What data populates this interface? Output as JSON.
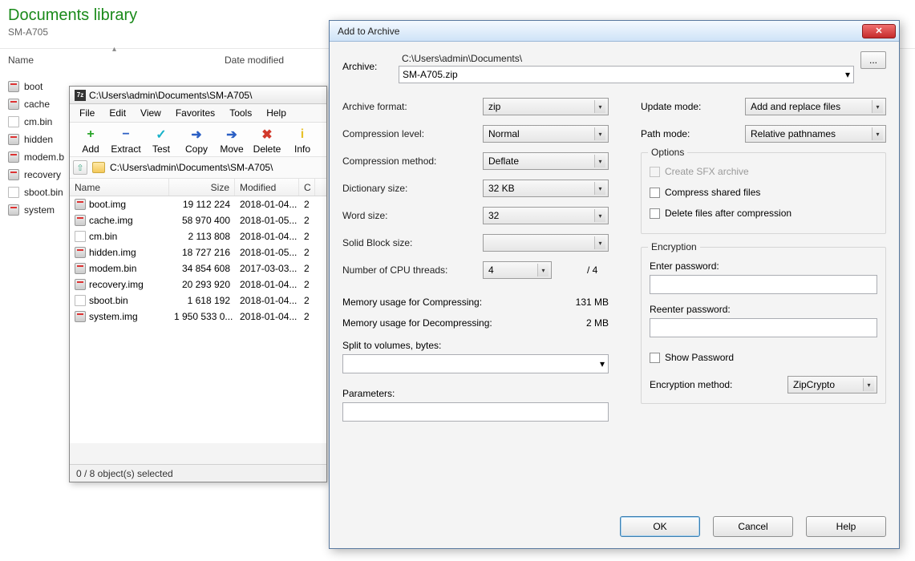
{
  "explorer": {
    "title": "Documents library",
    "subtitle": "SM-A705",
    "col_name": "Name",
    "col_date": "Date modified",
    "items": [
      {
        "name": "boot",
        "type": "disk"
      },
      {
        "name": "cache",
        "type": "disk"
      },
      {
        "name": "cm.bin",
        "type": "file"
      },
      {
        "name": "hidden",
        "type": "disk"
      },
      {
        "name": "modem.b",
        "type": "disk"
      },
      {
        "name": "recovery",
        "type": "disk"
      },
      {
        "name": "sboot.bin",
        "type": "file"
      },
      {
        "name": "system",
        "type": "disk"
      }
    ]
  },
  "sevenzip": {
    "title": "C:\\Users\\admin\\Documents\\SM-A705\\",
    "menu": [
      "File",
      "Edit",
      "View",
      "Favorites",
      "Tools",
      "Help"
    ],
    "tools": [
      {
        "label": "Add",
        "icon": "+",
        "color": "#2aa52a"
      },
      {
        "label": "Extract",
        "icon": "−",
        "color": "#2b5fc4"
      },
      {
        "label": "Test",
        "icon": "✓",
        "color": "#18b2c9"
      },
      {
        "label": "Copy",
        "icon": "➜",
        "color": "#2b5fc4"
      },
      {
        "label": "Move",
        "icon": "➔",
        "color": "#2b5fc4"
      },
      {
        "label": "Delete",
        "icon": "✖",
        "color": "#d23a2c"
      },
      {
        "label": "Info",
        "icon": "i",
        "color": "#e7c12a"
      }
    ],
    "address": "C:\\Users\\admin\\Documents\\SM-A705\\",
    "cols": {
      "name": "Name",
      "size": "Size",
      "modified": "Modified",
      "x": "C"
    },
    "rows": [
      {
        "name": "boot.img",
        "type": "disk",
        "size": "19 112 224",
        "mod": "2018-01-04...",
        "x": "2"
      },
      {
        "name": "cache.img",
        "type": "disk",
        "size": "58 970 400",
        "mod": "2018-01-05...",
        "x": "2"
      },
      {
        "name": "cm.bin",
        "type": "file",
        "size": "2 113 808",
        "mod": "2018-01-04...",
        "x": "2"
      },
      {
        "name": "hidden.img",
        "type": "disk",
        "size": "18 727 216",
        "mod": "2018-01-05...",
        "x": "2"
      },
      {
        "name": "modem.bin",
        "type": "disk",
        "size": "34 854 608",
        "mod": "2017-03-03...",
        "x": "2"
      },
      {
        "name": "recovery.img",
        "type": "disk",
        "size": "20 293 920",
        "mod": "2018-01-04...",
        "x": "2"
      },
      {
        "name": "sboot.bin",
        "type": "file",
        "size": "1 618 192",
        "mod": "2018-01-04...",
        "x": "2"
      },
      {
        "name": "system.img",
        "type": "disk",
        "size": "1 950 533 0...",
        "mod": "2018-01-04...",
        "x": "2"
      }
    ],
    "status": "0 / 8 object(s) selected"
  },
  "dialog": {
    "title": "Add to Archive",
    "archive_label": "Archive:",
    "archive_path": "C:\\Users\\admin\\Documents\\",
    "archive_file": "SM-A705.zip",
    "browse": "...",
    "fields": {
      "format_lbl": "Archive format:",
      "format_val": "zip",
      "level_lbl": "Compression level:",
      "level_val": "Normal",
      "method_lbl": "Compression method:",
      "method_val": "Deflate",
      "dict_lbl": "Dictionary size:",
      "dict_val": "32 KB",
      "word_lbl": "Word size:",
      "word_val": "32",
      "solid_lbl": "Solid Block size:",
      "solid_val": "",
      "threads_lbl": "Number of CPU threads:",
      "threads_val": "4",
      "threads_total": "/ 4",
      "memc_lbl": "Memory usage for Compressing:",
      "memc_val": "131 MB",
      "memd_lbl": "Memory usage for Decompressing:",
      "memd_val": "2 MB",
      "split_lbl": "Split to volumes, bytes:",
      "param_lbl": "Parameters:"
    },
    "right": {
      "update_lbl": "Update mode:",
      "update_val": "Add and replace files",
      "pathmode_lbl": "Path mode:",
      "pathmode_val": "Relative pathnames",
      "options_title": "Options",
      "opt_sfx": "Create SFX archive",
      "opt_shared": "Compress shared files",
      "opt_delete": "Delete files after compression",
      "enc_title": "Encryption",
      "pwd1_lbl": "Enter password:",
      "pwd2_lbl": "Reenter password:",
      "showpwd": "Show Password",
      "encm_lbl": "Encryption method:",
      "encm_val": "ZipCrypto"
    },
    "buttons": {
      "ok": "OK",
      "cancel": "Cancel",
      "help": "Help"
    }
  }
}
